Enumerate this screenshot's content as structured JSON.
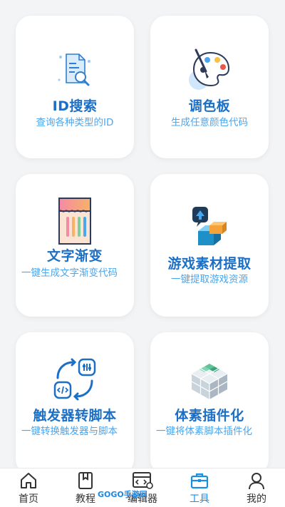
{
  "cards": [
    {
      "title": "ID搜索",
      "desc": "查询各种类型的ID",
      "icon": "document-search-icon"
    },
    {
      "title": "调色板",
      "desc": "生成任意颜色代码",
      "icon": "palette-icon"
    },
    {
      "title": "文字渐变",
      "desc": "一键生成文字渐变代码",
      "icon": "text-gradient-icon"
    },
    {
      "title": "游戏素材提取",
      "desc": "一键提取游戏资源",
      "icon": "game-assets-icon"
    },
    {
      "title": "触发器转脚本",
      "desc": "一键转换触发器与脚本",
      "icon": "trigger-convert-icon"
    },
    {
      "title": "体素插件化",
      "desc": "一键将体素脚本插件化",
      "icon": "voxel-cube-icon"
    }
  ],
  "tabbar": {
    "items": [
      {
        "label": "首页",
        "icon": "home-icon"
      },
      {
        "label": "教程",
        "icon": "book-icon"
      },
      {
        "label": "编辑器",
        "icon": "code-window-icon"
      },
      {
        "label": "工具",
        "icon": "toolbox-icon",
        "active": true
      },
      {
        "label": "我的",
        "icon": "user-icon"
      }
    ]
  },
  "watermark": "GOGO手游网",
  "colors": {
    "accent": "#1b6fc6",
    "desc": "#4aa6ee",
    "active_tab": "#1b8ee0"
  }
}
